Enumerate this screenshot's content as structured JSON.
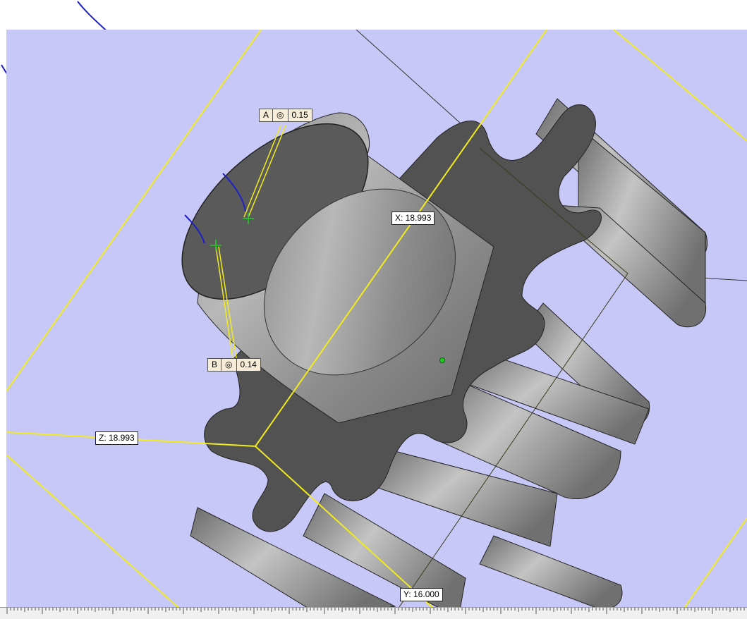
{
  "dimensions": {
    "x_label": "X: 18.993",
    "y_label": "Y: 16.000",
    "z_label": "Z: 18.993"
  },
  "tolerances": [
    {
      "datum": "A",
      "symbol": "◎",
      "value": "0.15"
    },
    {
      "datum": "B",
      "symbol": "◎",
      "value": "0.14"
    }
  ],
  "colors": {
    "viewport_bg": "#c8c8f8",
    "guide_line": "#f2ec1c",
    "annotation_stroke": "#1f1fc8",
    "part_dark": "#505050",
    "part_light": "#b4b4b4",
    "marker_green": "#22cc22"
  },
  "icons": {
    "origin_marker": "green-dot-icon",
    "pick_point": "crosshair-icon"
  }
}
